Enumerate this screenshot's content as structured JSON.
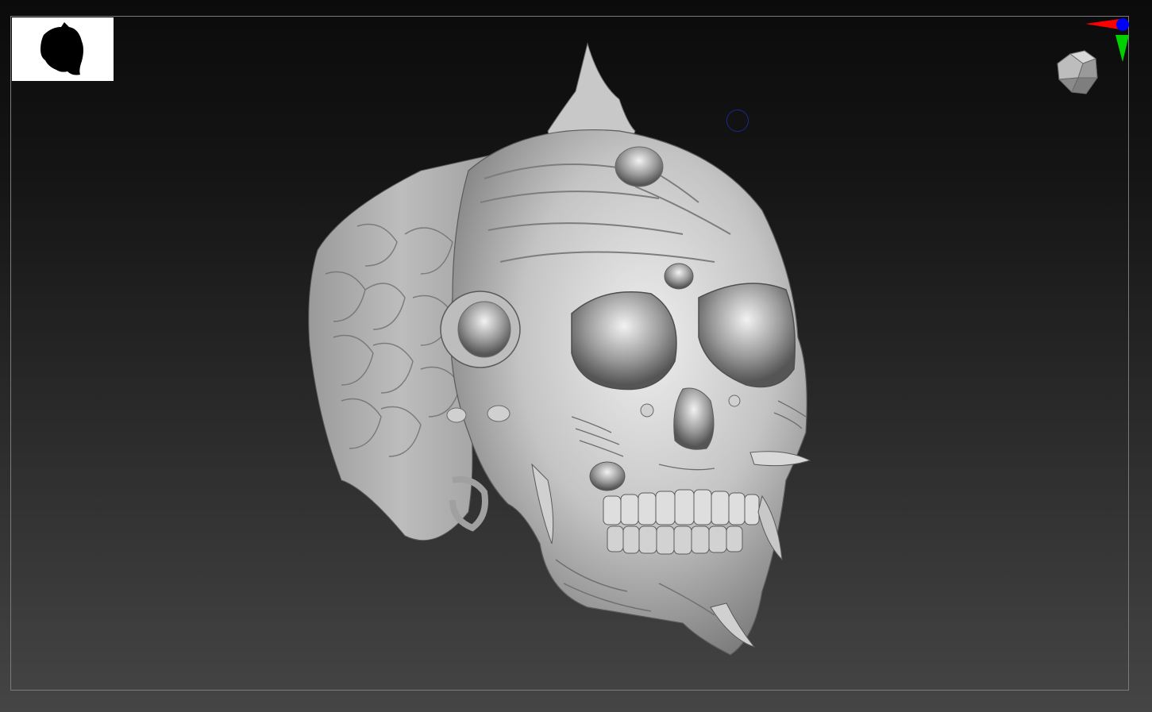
{
  "viewport": {
    "background_top": "#0b0b0b",
    "background_bottom": "#454545",
    "frame_color": "#7a7a7a"
  },
  "thumbnail": {
    "icon": "skull-silhouette-icon",
    "background": "#ffffff"
  },
  "navigation_gizmo": {
    "icon": "view-cube-icon",
    "axis_colors": {
      "x": "#ff0000",
      "y": "#00ff00",
      "z": "#0000ff"
    }
  },
  "brush_cursor": {
    "icon": "brush-cursor-icon",
    "color": "#1a2a8a"
  },
  "model": {
    "icon": "sculpted-skull-ring-model",
    "material_color": "#c8c8c8"
  }
}
